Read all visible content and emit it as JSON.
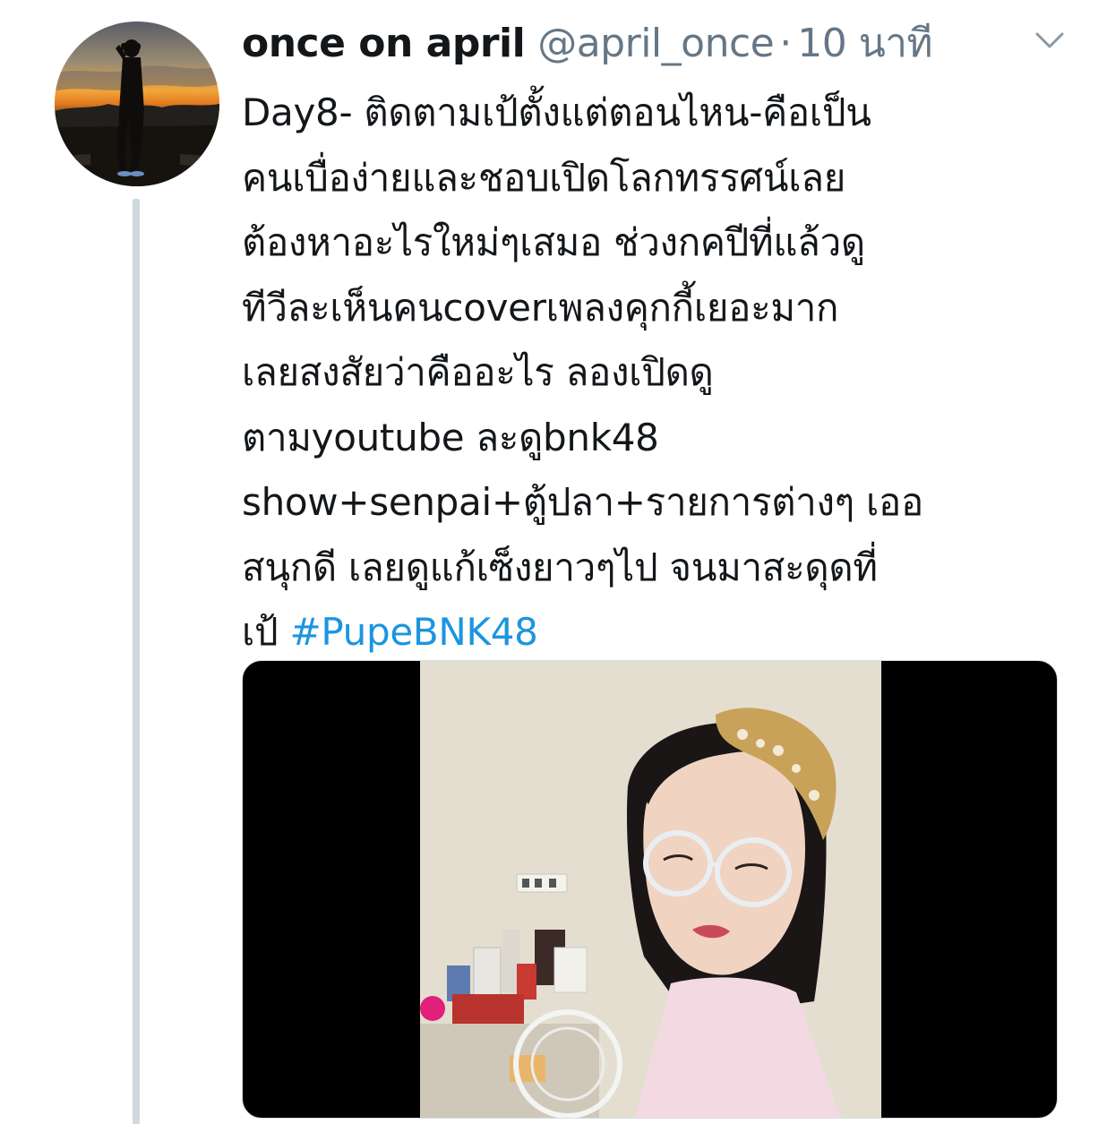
{
  "tweet": {
    "display_name": "once on april",
    "handle": "@april_once",
    "separator": "·",
    "timestamp": "10 นาที",
    "text_lines": [
      "Day8- ติดตามเป้ตั้งแต่ตอนไหน-คือเป็น",
      "คนเบื่อง่ายและชอบเปิดโลกทรรศน์เลย",
      "ต้องหาอะไรใหม่ๆเสมอ ช่วงกคปีที่แล้วดู",
      "ทีวีละเห็นคนcoverเพลงคุกกี้เยอะมาก",
      "เลยสงสัยว่าคืออะไร ลองเปิดดู",
      "ตามyoutube ละดูbnk48",
      "show+senpai+ตู้ปลา+รายการต่างๆ เออ",
      "สนุกดี เลยดูแก้เซ็งยาวๆไป จนมาสะดุดที่"
    ],
    "last_line_prefix": "เป้ ",
    "hashtag": "#PupeBNK48",
    "colors": {
      "text": "#14171a",
      "secondary": "#657786",
      "link": "#1b95e0",
      "thread_line": "#cfd9de"
    },
    "icons": {
      "menu": "chevron-down-icon",
      "avatar": "avatar"
    }
  }
}
